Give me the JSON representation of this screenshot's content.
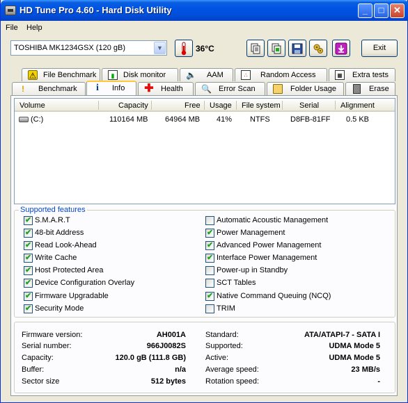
{
  "window": {
    "title": "HD Tune Pro 4.60 - Hard Disk Utility"
  },
  "titlebar_buttons": {
    "minimize": "_",
    "maximize": "□",
    "close": "✕"
  },
  "menu": {
    "file": "File",
    "help": "Help"
  },
  "toolbar": {
    "drive": "TOSHIBA MK1234GSX (120 gB)",
    "temperature": "36°C",
    "exit_label": "Exit",
    "icons": [
      "thermometer-icon",
      "copy-text-icon",
      "copy-screenshot-icon",
      "save-icon",
      "options-icon",
      "download-icon"
    ]
  },
  "tabs_top": [
    {
      "label": "File Benchmark",
      "icon": "file-benchmark-icon"
    },
    {
      "label": "Disk monitor",
      "icon": "disk-monitor-icon"
    },
    {
      "label": "AAM",
      "icon": "speaker-icon"
    },
    {
      "label": "Random Access",
      "icon": "random-access-icon"
    },
    {
      "label": "Extra tests",
      "icon": "extra-tests-icon"
    }
  ],
  "tabs_bottom": [
    {
      "label": "Benchmark",
      "icon": "benchmark-icon"
    },
    {
      "label": "Info",
      "icon": "info-icon"
    },
    {
      "label": "Health",
      "icon": "health-icon"
    },
    {
      "label": "Error Scan",
      "icon": "error-scan-icon"
    },
    {
      "label": "Folder Usage",
      "icon": "folder-icon"
    },
    {
      "label": "Erase",
      "icon": "trash-icon"
    }
  ],
  "volumes": {
    "columns": [
      "Volume",
      "Capacity",
      "Free",
      "Usage",
      "File system",
      "Serial",
      "Alignment"
    ],
    "rows": [
      {
        "volume": "(C:)",
        "capacity": "110164 MB",
        "free": "64964 MB",
        "usage": "41%",
        "fs": "NTFS",
        "serial": "D8FB-81FF",
        "alignment": "0.5 KB"
      }
    ]
  },
  "features": {
    "title": "Supported features",
    "left": [
      {
        "label": "S.M.A.R.T",
        "checked": true
      },
      {
        "label": "48-bit Address",
        "checked": true
      },
      {
        "label": "Read Look-Ahead",
        "checked": true
      },
      {
        "label": "Write Cache",
        "checked": true
      },
      {
        "label": "Host Protected Area",
        "checked": true
      },
      {
        "label": "Device Configuration Overlay",
        "checked": true
      },
      {
        "label": "Firmware Upgradable",
        "checked": true
      },
      {
        "label": "Security Mode",
        "checked": true
      }
    ],
    "right": [
      {
        "label": "Automatic Acoustic Management",
        "checked": false
      },
      {
        "label": "Power Management",
        "checked": true
      },
      {
        "label": "Advanced Power Management",
        "checked": true
      },
      {
        "label": "Interface Power Management",
        "checked": true
      },
      {
        "label": "Power-up in Standby",
        "checked": false
      },
      {
        "label": "SCT Tables",
        "checked": false
      },
      {
        "label": "Native Command Queuing (NCQ)",
        "checked": true
      },
      {
        "label": "TRIM",
        "checked": false
      }
    ]
  },
  "details": {
    "left": [
      {
        "label": "Firmware version:",
        "value": "AH001A"
      },
      {
        "label": "Serial number:",
        "value": "966J0082S"
      },
      {
        "label": "Capacity:",
        "value": "120.0 gB (111.8 GB)"
      },
      {
        "label": "Buffer:",
        "value": "n/a"
      },
      {
        "label": "Sector size",
        "value": "512 bytes"
      }
    ],
    "right": [
      {
        "label": "Standard:",
        "value": "ATA/ATAPI-7 - SATA I"
      },
      {
        "label": "Supported:",
        "value": "UDMA Mode 5"
      },
      {
        "label": "Active:",
        "value": "UDMA Mode 5"
      },
      {
        "label": "Average speed:",
        "value": "23 MB/s"
      },
      {
        "label": "Rotation speed:",
        "value": "-"
      }
    ]
  }
}
